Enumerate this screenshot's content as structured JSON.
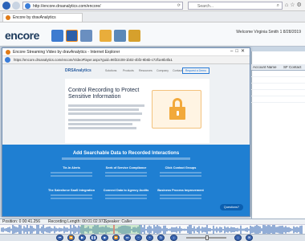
{
  "browser": {
    "address": "http://encore.drsanalytics.com/encore/",
    "search_placeholder": "Search...",
    "tab_title": "Encore by dravAnalytics"
  },
  "app": {
    "logo": "encore",
    "welcome": "Welcome Virginia Smith 1 8/28/2019",
    "side_headers": [
      "Account Name",
      "SF Contact"
    ]
  },
  "popup": {
    "title": "Encore Streaming Video by dravAnalytics - Internet Explorer",
    "address": "https://encore.drsanalytics.com/encore/VideoPlayer.aspx?guid=96f22c08-1b02-4bf2-9b6b-c72f1e8b4fa1",
    "page": {
      "brand": "DRSAnalytics",
      "nav_links": [
        "Solutions",
        "Products",
        "Resources",
        "Company",
        "Contact"
      ],
      "demo_label": "Request a Demo",
      "hero_title": "Control Recording to Protect Sensitive Information",
      "features_title": "Add Searchable Data to Recorded Interactions",
      "feature_headings": [
        "Tie-In Alerts",
        "Seek of Service Compliance",
        "Click Contact Groups",
        "The Salesforce SaaS Integration",
        "Connect Data to Agency Audits",
        "Business Process Improvement"
      ],
      "chat_label": "Questions?"
    }
  },
  "player": {
    "position": "Position: 0 00:41.256",
    "length": "Recording Length: 00:01:02.972",
    "speaker": "Speaker: Caller"
  }
}
